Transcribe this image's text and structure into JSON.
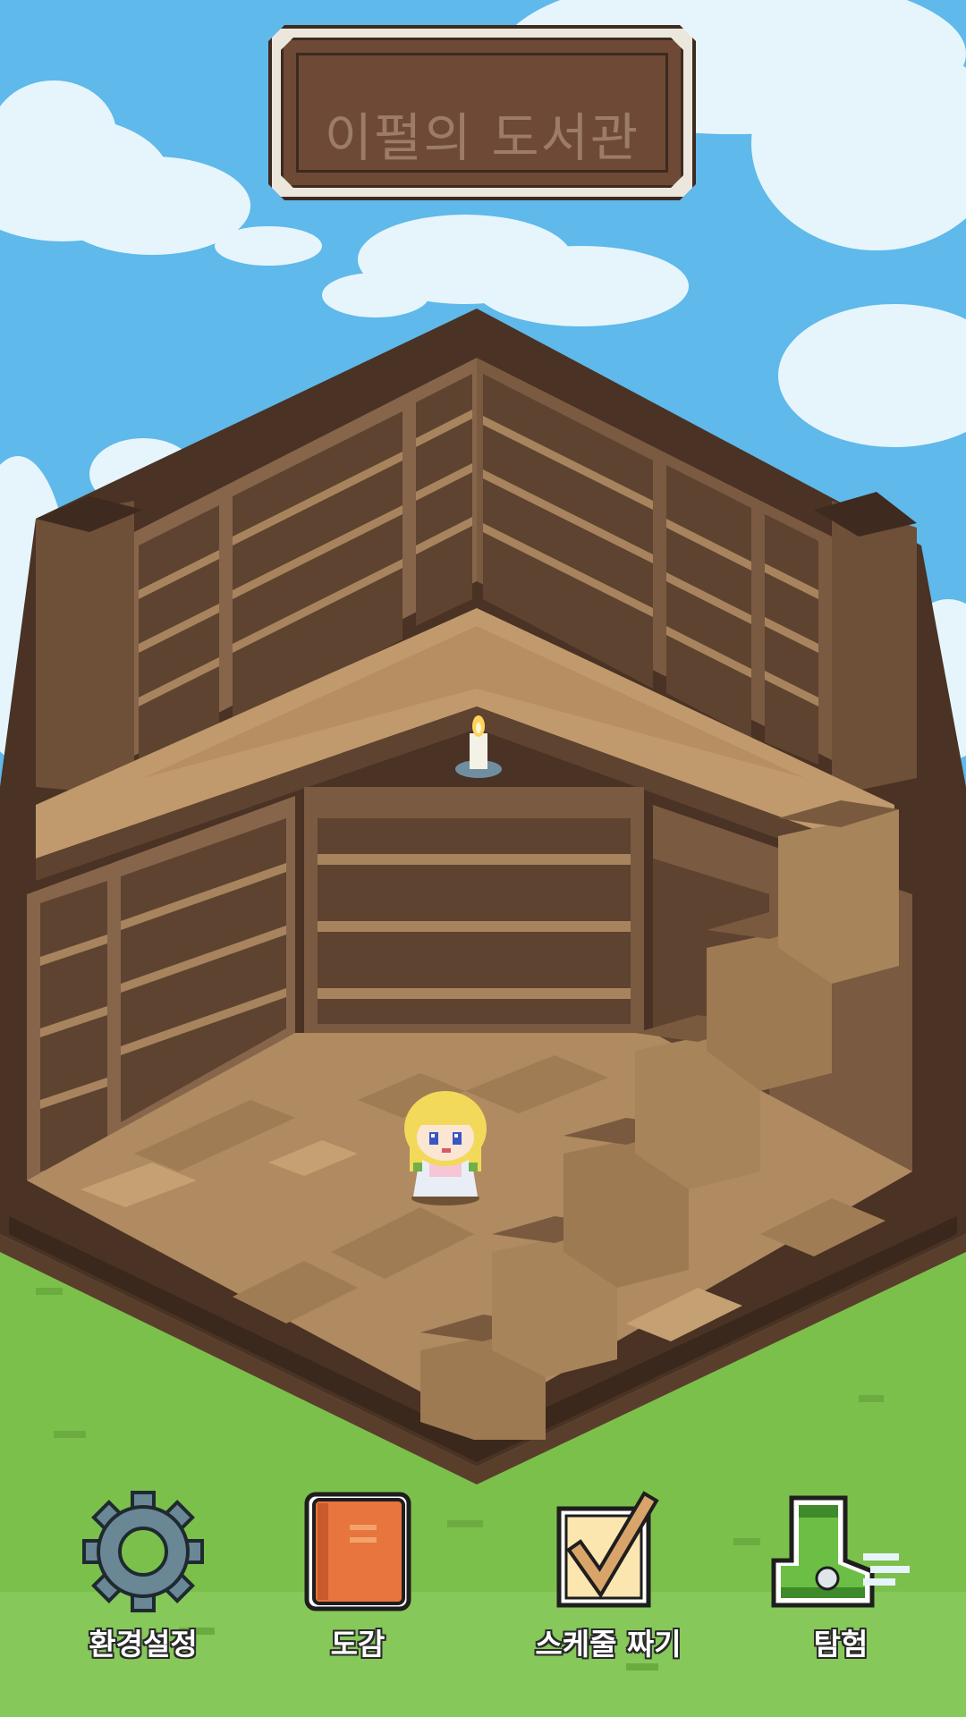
{
  "title": "이펄의 도서관",
  "menu": [
    {
      "label": "환경설정",
      "icon": "gear-icon"
    },
    {
      "label": "도감",
      "icon": "book-icon"
    },
    {
      "label": "스케줄 짜기",
      "icon": "checklist-icon"
    },
    {
      "label": "탐험",
      "icon": "boot-icon"
    }
  ],
  "colors": {
    "sky": "#5bb8ea",
    "grass": "#7fc04f",
    "wood_dark": "#4a3426",
    "wood_mid": "#8a6a4c",
    "floor": "#b08a60",
    "plaque": "#6e4a36"
  }
}
